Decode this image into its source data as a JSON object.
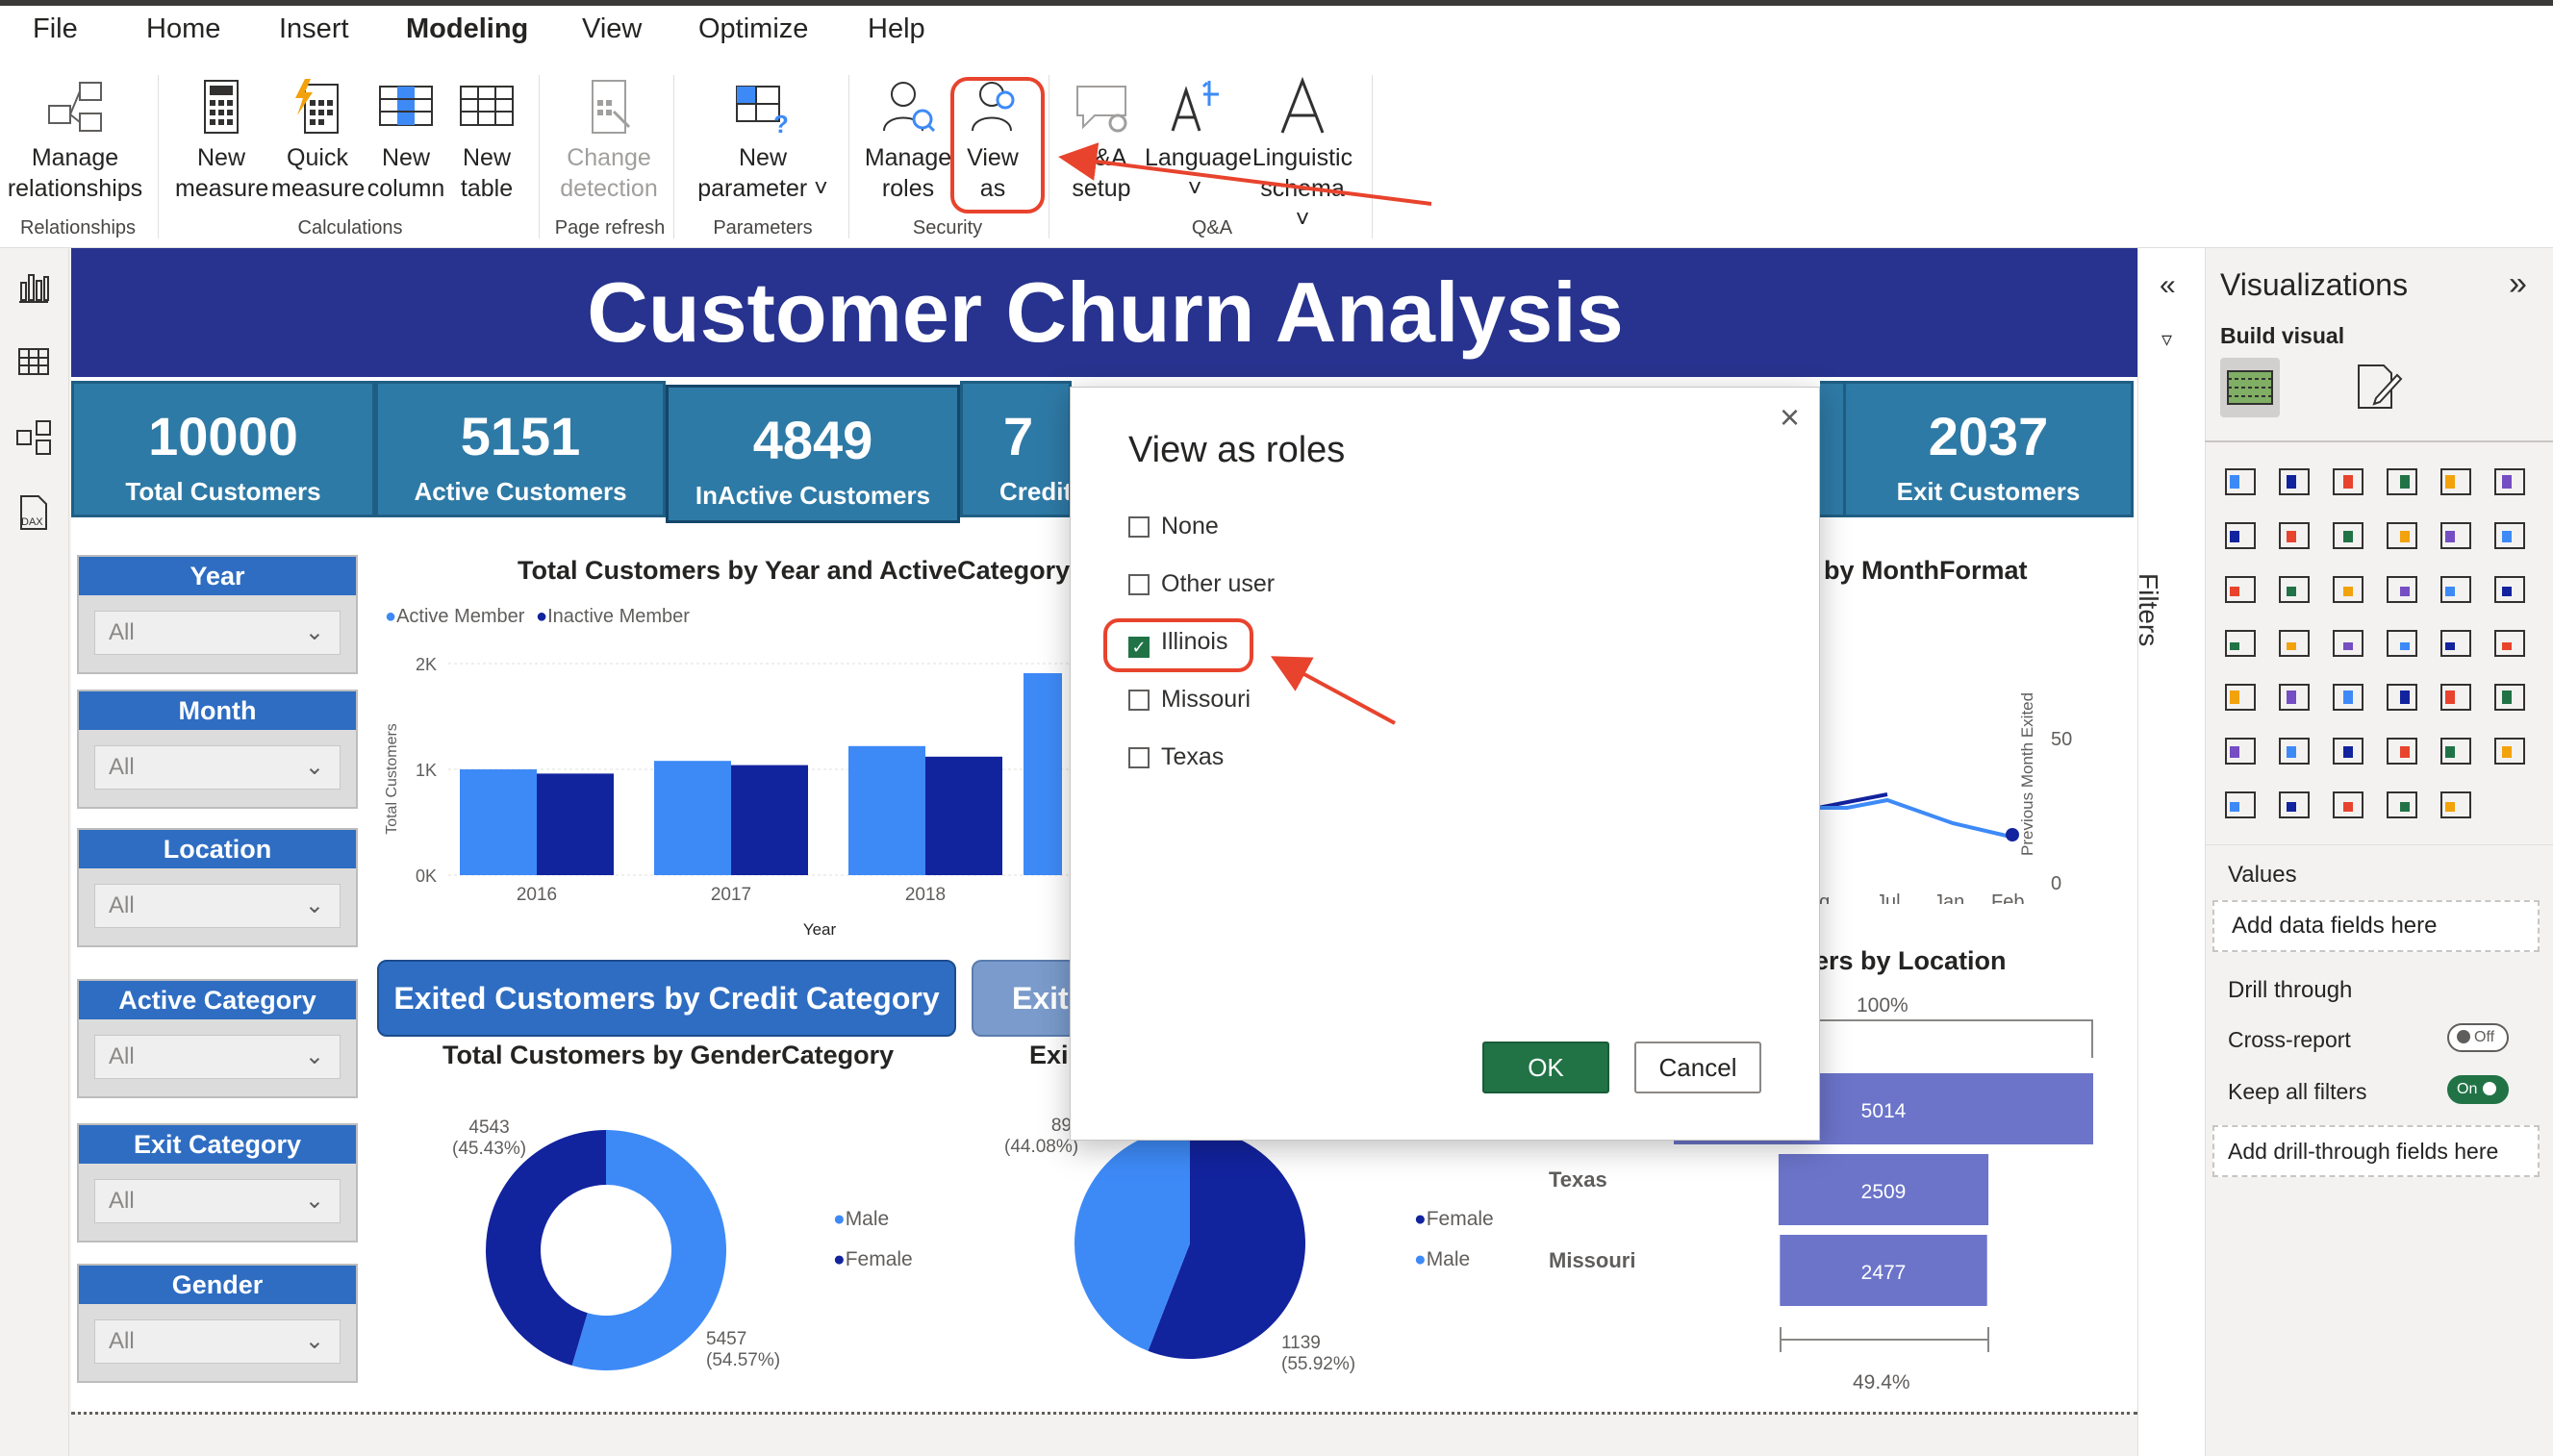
{
  "menu": [
    "File",
    "Home",
    "Insert",
    "Modeling",
    "View",
    "Optimize",
    "Help"
  ],
  "ribbon": {
    "buttons": [
      {
        "l1": "Manage",
        "l2": "relationships"
      },
      {
        "l1": "New",
        "l2": "measure"
      },
      {
        "l1": "Quick",
        "l2": "measure"
      },
      {
        "l1": "New",
        "l2": "column"
      },
      {
        "l1": "New",
        "l2": "table"
      },
      {
        "l1": "Change",
        "l2": "detection"
      },
      {
        "l1": "New",
        "l2": "parameter ˅"
      },
      {
        "l1": "Manage",
        "l2": "roles"
      },
      {
        "l1": "View",
        "l2": "as"
      },
      {
        "l1": "Q&A",
        "l2": "setup"
      },
      {
        "l1": "Language",
        "l2": "˅"
      },
      {
        "l1": "Linguistic",
        "l2": "schema ˅"
      }
    ],
    "groups": [
      "Relationships",
      "Calculations",
      "Page refresh",
      "Parameters",
      "Security",
      "Q&A"
    ]
  },
  "report": {
    "title": "Customer Churn Analysis",
    "kpis": [
      {
        "value": "10000",
        "label": "Total Customers"
      },
      {
        "value": "5151",
        "label": "Active Customers"
      },
      {
        "value": "4849",
        "label": "InActive Customers"
      },
      {
        "value": "7",
        "label": "Credit"
      },
      {
        "value": "2037",
        "label": "Exit Customers"
      }
    ],
    "slicers": [
      {
        "header": "Year",
        "value": "All"
      },
      {
        "header": "Month",
        "value": "All"
      },
      {
        "header": "Location",
        "value": "All"
      },
      {
        "header": "Active Category",
        "value": "All"
      },
      {
        "header": "Exit Category",
        "value": "All"
      },
      {
        "header": "Gender",
        "value": "All"
      }
    ],
    "buttons": {
      "exited_credit": "Exited Customers by Credit Category",
      "exited_partial": "Exite"
    },
    "partial_title_month": "by MonthFormat",
    "partial_title_location": "ers by Location",
    "partial_title_exit": "Exi",
    "month_ticks": [
      "ug",
      "Jul",
      "Jan",
      "Feb"
    ],
    "month_axis": {
      "y_label": "Previous Month Exited",
      "ticks": [
        "50",
        "0"
      ]
    }
  },
  "chart_data": [
    {
      "type": "bar",
      "title": "Total Customers by Year and ActiveCategory",
      "xlabel": "Year",
      "ylabel": "Total Customers",
      "categories": [
        "2016",
        "2017",
        "2018"
      ],
      "series": [
        {
          "name": "Active Member",
          "values": [
            1000,
            1080,
            1220
          ]
        },
        {
          "name": "Inactive Member",
          "values": [
            960,
            1040,
            1120
          ]
        }
      ],
      "yticks": [
        "2K",
        "1K",
        "0K"
      ],
      "ylim": [
        0,
        2000
      ],
      "colors": [
        "#3d8af7",
        "#12239e"
      ]
    },
    {
      "type": "pie",
      "title": "Total Customers by GenderCategory",
      "donut": true,
      "labels": [
        "Male",
        "Female"
      ],
      "values": [
        5457,
        4543
      ],
      "label_text": [
        {
          "value": "4543",
          "pct": "(45.43%)"
        },
        {
          "value": "5457",
          "pct": "(54.57%)"
        }
      ],
      "colors": [
        "#3d8af7",
        "#12239e"
      ]
    },
    {
      "type": "pie",
      "labels": [
        "Female",
        "Male"
      ],
      "values": [
        1139,
        898
      ],
      "label_text": [
        {
          "value": "89",
          "pct": "(44.08%)"
        },
        {
          "value": "1139",
          "pct": "(55.92%)"
        }
      ],
      "colors": [
        "#12239e",
        "#3d8af7"
      ]
    },
    {
      "type": "bar",
      "orientation": "horizontal",
      "categories": [
        "",
        "Texas",
        "Missouri"
      ],
      "values": [
        5014,
        2509,
        2477
      ],
      "top_label": "100%",
      "bottom_label": "49.4%",
      "colors": [
        "#6b74c9"
      ]
    }
  ],
  "filters_pane": {
    "label": "Filters"
  },
  "viz_pane": {
    "title": "Visualizations",
    "build": "Build visual",
    "values": "Values",
    "add_data": "Add data fields here",
    "drill": "Drill through",
    "cross": "Cross-report",
    "cross_state": "Off",
    "keep": "Keep all filters",
    "keep_state": "On",
    "add_drill": "Add drill-through fields here"
  },
  "modal": {
    "title": "View as roles",
    "roles": [
      {
        "label": "None",
        "checked": false
      },
      {
        "label": "Other user",
        "checked": false
      },
      {
        "label": "Illinois",
        "checked": true
      },
      {
        "label": "Missouri",
        "checked": false
      },
      {
        "label": "Texas",
        "checked": false
      }
    ],
    "ok": "OK",
    "cancel": "Cancel"
  },
  "annotation_color": "#e8432d"
}
